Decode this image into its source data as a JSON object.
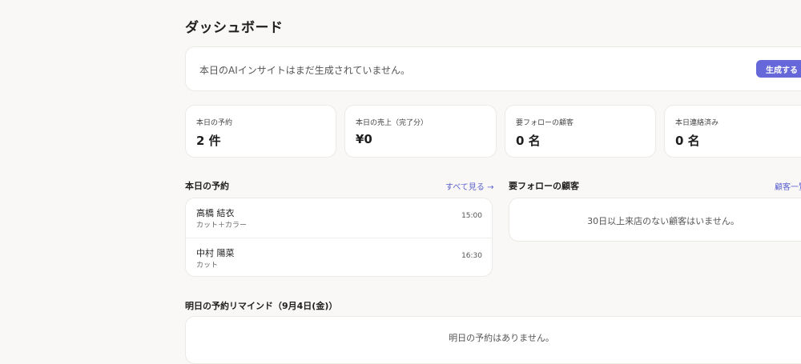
{
  "header": {
    "title": "ダッシュボード"
  },
  "insight": {
    "message": "本日のAIインサイトはまだ生成されていません。",
    "generate_label": "生成する"
  },
  "stats": [
    {
      "label": "本日の予約",
      "value": "2 件"
    },
    {
      "label": "本日の売上（完了分）",
      "value": "¥0"
    },
    {
      "label": "要フォローの顧客",
      "value": "0 名"
    },
    {
      "label": "本日連絡済み",
      "value": "0 名"
    }
  ],
  "today": {
    "title": "本日の予約",
    "link_label": "すべて見る →",
    "reservations": [
      {
        "name": "高橋 結衣",
        "menu": "カット＋カラー",
        "time": "15:00"
      },
      {
        "name": "中村 陽菜",
        "menu": "カット",
        "time": "16:30"
      }
    ]
  },
  "followup": {
    "title": "要フォローの顧客",
    "link_label": "顧客一覧",
    "empty_message": "30日以上来店のない顧客はいません。"
  },
  "reminder": {
    "title": "明日の予約リマインド（9月4日(金)）",
    "empty_message": "明日の予約はありません。"
  },
  "colors": {
    "accent": "#6668d9",
    "link": "#5b5fd0",
    "background": "#f9f8f6"
  }
}
